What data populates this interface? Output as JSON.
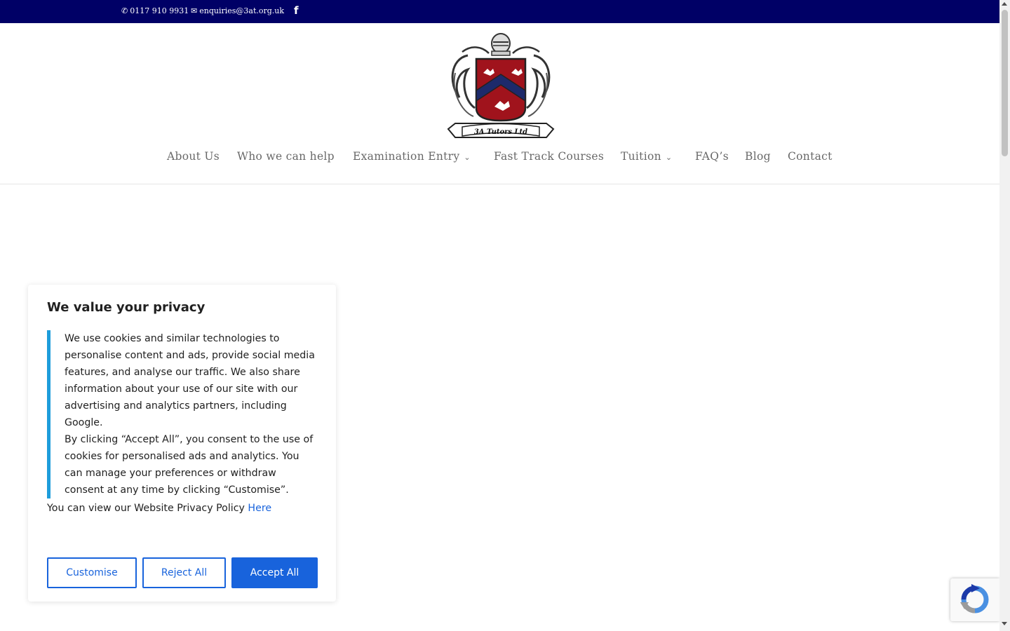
{
  "topbar": {
    "phone": "0117 910 9931",
    "email": "enquiries@3at.org.uk",
    "facebook_glyph": "f",
    "icons": {
      "phone": "phone-icon",
      "email": "envelope-icon",
      "social": "facebook-icon"
    }
  },
  "logo": {
    "banner_text": "3A Tutors Ltd"
  },
  "nav": {
    "items": [
      {
        "label": "About Us"
      },
      {
        "label": "Who we can help"
      },
      {
        "label": "Examination Entry",
        "dropdown": true
      },
      {
        "label": "Fast Track Courses"
      },
      {
        "label": "Tuition",
        "dropdown": true
      },
      {
        "label": "FAQ’s"
      },
      {
        "label": "Blog"
      },
      {
        "label": "Contact"
      }
    ],
    "chevron_glyph": "⌄"
  },
  "cookie": {
    "title": "We value your privacy",
    "para1": "We use cookies and similar technologies to personalise content and ads, provide social media features, and analyse our traffic. We also share information about your use of our site with our advertising and analytics partners, including Google.",
    "para2": "By clicking “Accept All”, you consent to the use of cookies for personalised ads and analytics. You can manage your preferences or withdraw consent at any time by clicking “Customise”.",
    "policy_text": "You can view our Website Privacy Policy ",
    "policy_link": "Here",
    "buttons": {
      "customise": "Customise",
      "reject": "Reject All",
      "accept": "Accept All"
    }
  },
  "colors": {
    "topbar_bg": "#000066",
    "accent_blue": "#1863dc",
    "border_blue": "#1e9ddb",
    "shield_red": "#a0131c",
    "shield_navy": "#1d2a6b"
  }
}
